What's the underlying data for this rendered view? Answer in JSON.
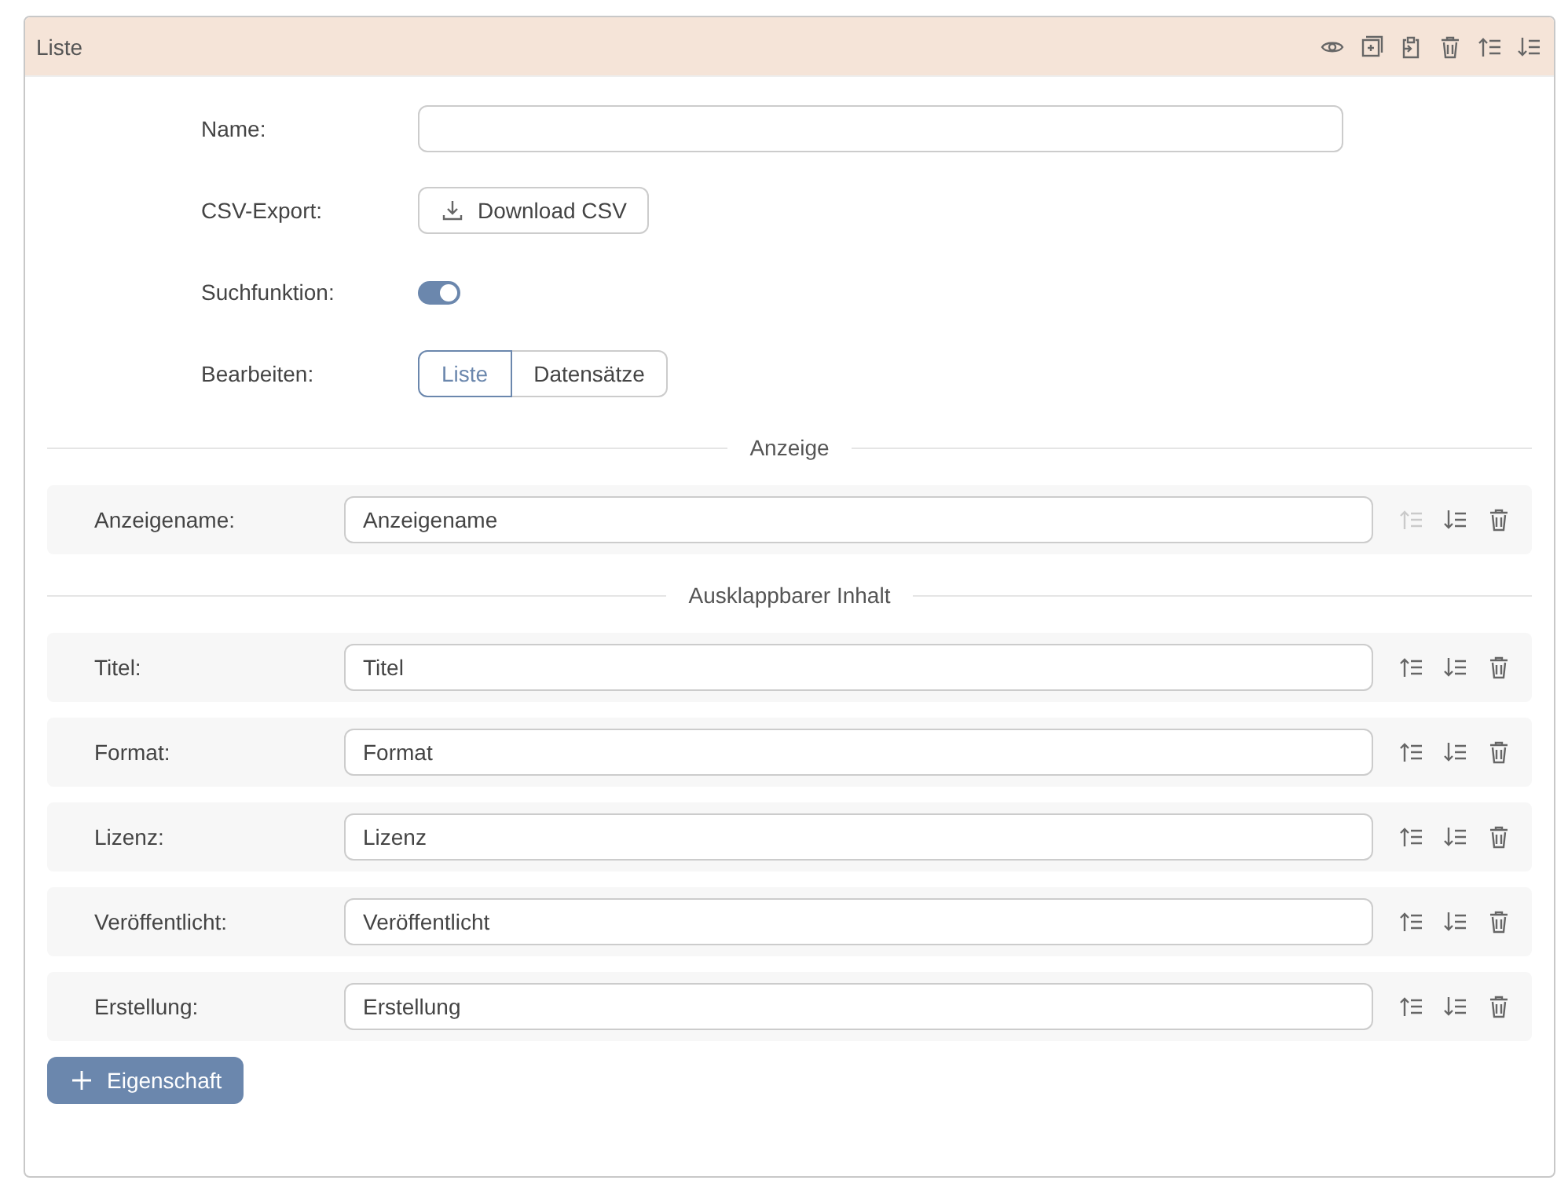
{
  "panel": {
    "title": "Liste"
  },
  "settings": [
    {
      "kind": "input",
      "label": "Name:"
    },
    {
      "kind": "button",
      "label": "CSV-Export:",
      "button": "Download CSV"
    },
    {
      "kind": "toggle",
      "label": "Suchfunktion:",
      "on": true
    },
    {
      "kind": "segmented",
      "label": "Bearbeiten:",
      "options": [
        {
          "label": "Liste",
          "selected": true
        },
        {
          "label": "Datensätze",
          "selected": false
        }
      ]
    }
  ],
  "sections": [
    {
      "title": "Anzeige",
      "rows": [
        {
          "label": "Anzeigename:",
          "value": "Anzeigename",
          "move_up_disabled": true
        }
      ]
    },
    {
      "title": "Ausklappbarer Inhalt",
      "rows": [
        {
          "label": "Titel:",
          "value": "Titel",
          "move_up_disabled": false
        },
        {
          "label": "Format:",
          "value": "Format",
          "move_up_disabled": false
        },
        {
          "label": "Lizenz:",
          "value": "Lizenz",
          "move_up_disabled": false
        },
        {
          "label": "Veröffentlicht:",
          "value": "Veröffentlicht",
          "move_up_disabled": false
        },
        {
          "label": "Erstellung:",
          "value": "Erstellung",
          "move_up_disabled": false
        }
      ]
    }
  ],
  "add_button": "Eigenschaft"
}
